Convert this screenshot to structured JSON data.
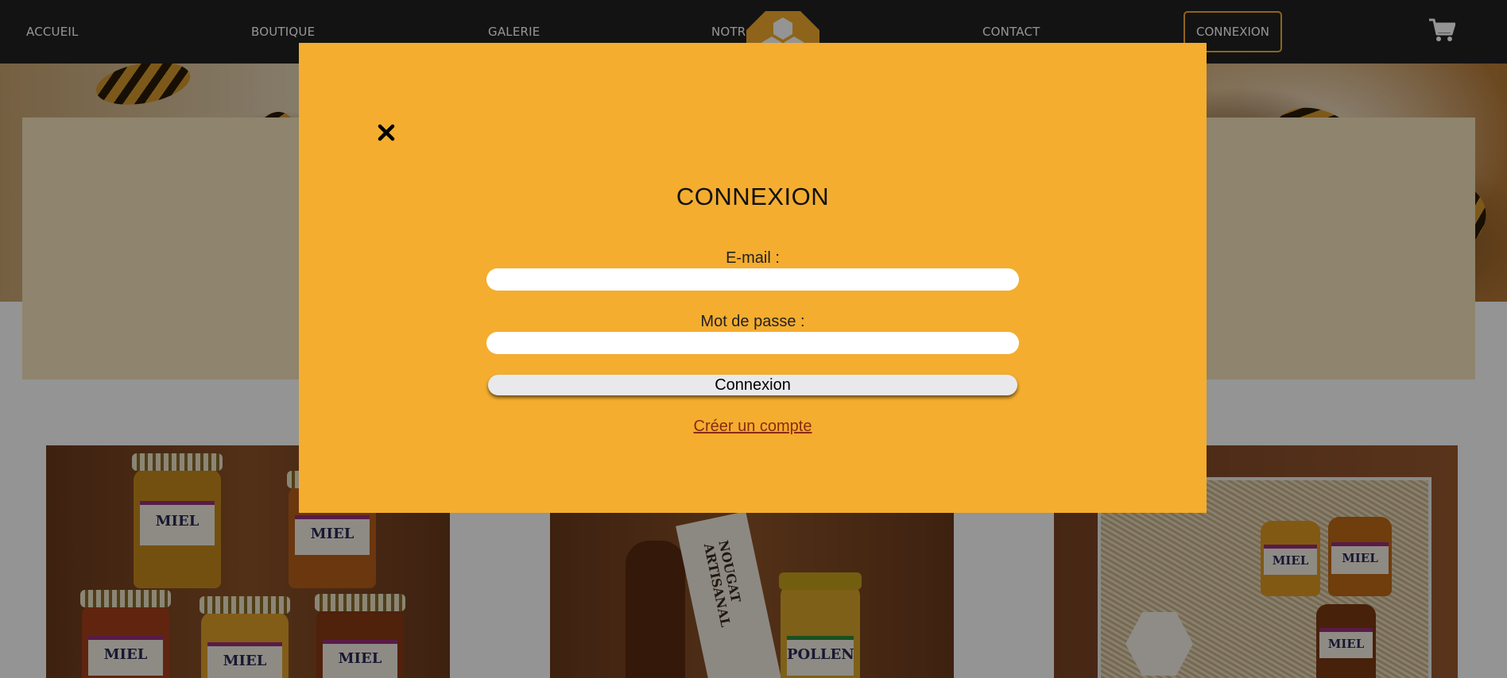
{
  "nav": {
    "items": [
      "ACCUEIL",
      "BOUTIQUE",
      "GALERIE",
      "NOTR",
      "CONTACT"
    ],
    "login_label": "CONNEXION"
  },
  "icons": {
    "cart": "shopping-cart-icon",
    "close": "close-icon",
    "logo": "honeycomb-logo-icon"
  },
  "products": [
    {
      "jar_labels": [
        "MIEL",
        "MIEL",
        "MIEL",
        "MIEL",
        "MIEL"
      ]
    },
    {
      "jar_labels": [
        "NOUGAT ARTISANAL",
        "POLLEN"
      ]
    },
    {
      "jar_labels": [
        "MIEL",
        "MIEL",
        "MIEL"
      ]
    }
  ],
  "modal": {
    "title": "CONNEXION",
    "email_label": "E-mail :",
    "email_value": "",
    "password_label": "Mot de passe :",
    "password_value": "",
    "submit_label": "Connexion",
    "create_account_label": "Créer un compte"
  },
  "colors": {
    "accent": "#f4ad2f",
    "navbar": "#222222",
    "link": "#8a2a12"
  }
}
